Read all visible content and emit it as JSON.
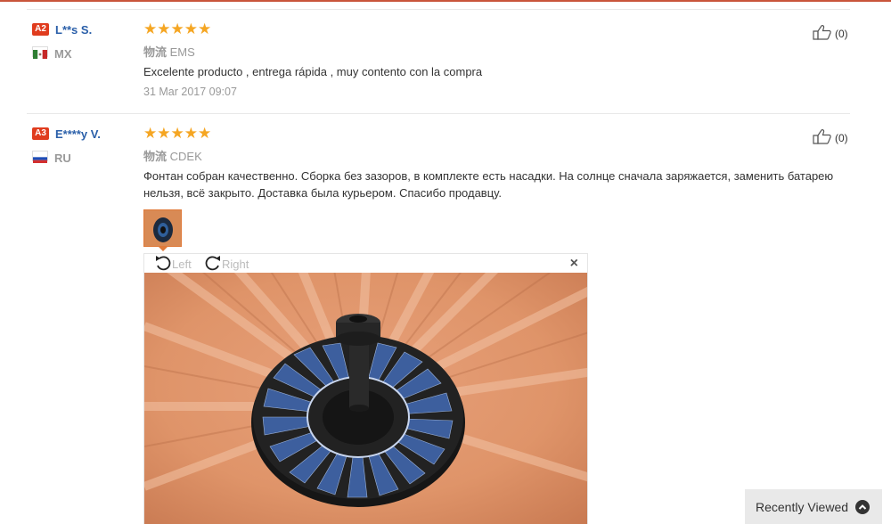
{
  "reviews": [
    {
      "level": "A2",
      "username": "L**s S.",
      "country_code": "MX",
      "stars": "★★★★★",
      "logistics_label": "物流",
      "logistics_value": "EMS",
      "text": "Excelente producto , entrega rápida , muy contento con la compra",
      "date": "31 Mar 2017 09:07",
      "helpful_count": "(0)"
    },
    {
      "level": "A3",
      "username": "E****y V.",
      "country_code": "RU",
      "stars": "★★★★★",
      "logistics_label": "物流",
      "logistics_value": "CDEK",
      "text": "Фонтан собран качественно. Сборка без зазоров, в комплекте есть насадки. На солнце сначала заряжается, заменить батарею нельзя, всё закрыто. Доставка была курьером. Спасибо продавцу.",
      "helpful_count": "(0)"
    }
  ],
  "image_viewer": {
    "rotate_left_label": "Left",
    "rotate_right_label": "Right",
    "close_symbol": "×"
  },
  "recently_viewed": {
    "label": "Recently Viewed"
  },
  "colors": {
    "accent": "#c9553b",
    "level_badge": "#e03c1e",
    "username": "#2a5fa9",
    "stars": "#f5a623"
  }
}
